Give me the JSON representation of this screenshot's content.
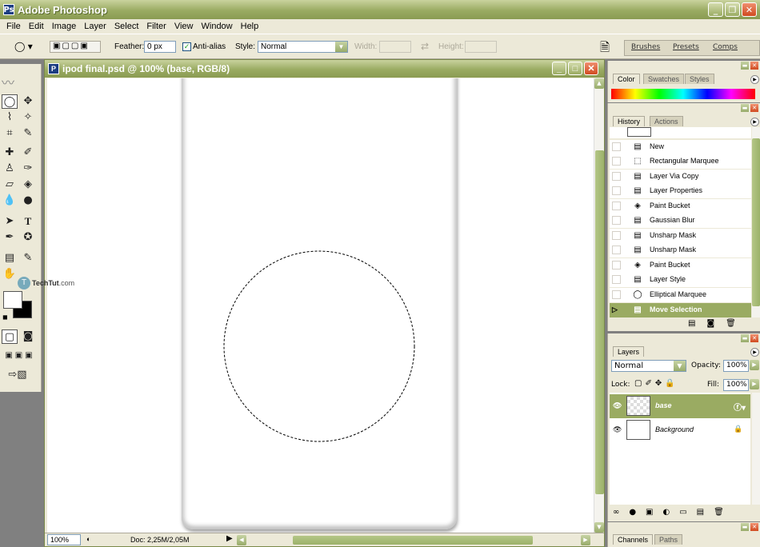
{
  "app": {
    "title": "Adobe Photoshop",
    "icon": "photoshop-logo-icon"
  },
  "menu": [
    "File",
    "Edit",
    "Image",
    "Layer",
    "Select",
    "Filter",
    "View",
    "Window",
    "Help"
  ],
  "options": {
    "feather_label": "Feather:",
    "feather_value": "0 px",
    "antialias_label": "Anti-alias",
    "antialias_checked": true,
    "style_label": "Style:",
    "style_value": "Normal",
    "width_label": "Width:",
    "height_label": "Height:"
  },
  "palette_well": {
    "tabs": [
      "Brushes",
      "Presets",
      "Comps"
    ]
  },
  "watermark": {
    "text": "TechTut",
    "suffix": ".com"
  },
  "document": {
    "title": "ipod final.psd @ 100% (base, RGB/8)",
    "zoom": "100%",
    "doc_size": "Doc: 2,25M/2,05M"
  },
  "color_panel": {
    "tabs": [
      "Color",
      "Swatches",
      "Styles"
    ]
  },
  "history_panel": {
    "tabs": [
      "History",
      "Actions"
    ],
    "items": [
      {
        "label": "New",
        "icon": "history-step-icon"
      },
      {
        "label": "Rectangular Marquee",
        "icon": "rect-marquee-icon"
      },
      {
        "label": "Layer Via Copy",
        "icon": "history-step-icon"
      },
      {
        "label": "Layer Properties",
        "icon": "history-step-icon"
      },
      {
        "label": "Paint Bucket",
        "icon": "paint-bucket-icon"
      },
      {
        "label": "Gaussian Blur",
        "icon": "history-step-icon"
      },
      {
        "label": "Unsharp Mask",
        "icon": "history-step-icon"
      },
      {
        "label": "Unsharp Mask",
        "icon": "history-step-icon"
      },
      {
        "label": "Paint Bucket",
        "icon": "paint-bucket-icon"
      },
      {
        "label": "Layer Style",
        "icon": "history-step-icon"
      },
      {
        "label": "Elliptical Marquee",
        "icon": "ellipse-marquee-icon"
      },
      {
        "label": "Move Selection",
        "icon": "history-step-icon",
        "selected": true
      }
    ]
  },
  "layers_panel": {
    "tab": "Layers",
    "blend_mode": "Normal",
    "opacity_label": "Opacity:",
    "opacity_value": "100%",
    "lock_label": "Lock:",
    "fill_label": "Fill:",
    "fill_value": "100%",
    "layers": [
      {
        "name": "base",
        "selected": true
      },
      {
        "name": "Background",
        "locked": true
      }
    ]
  },
  "channels_panel": {
    "tabs": [
      "Channels",
      "Paths"
    ]
  },
  "colors": {
    "accent": "#9aab62",
    "titlebar": "#8a9b52",
    "close": "#d04a20"
  }
}
